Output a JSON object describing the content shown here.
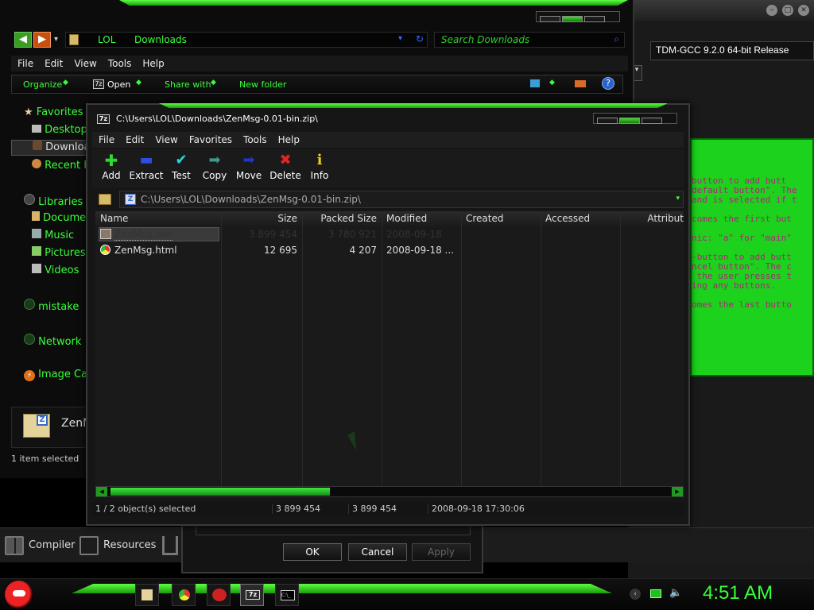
{
  "explorer": {
    "address": [
      "LOL",
      "Downloads"
    ],
    "search_placeholder": "Search Downloads",
    "menu": [
      "File",
      "Edit",
      "View",
      "Tools",
      "Help"
    ],
    "toolbar": [
      "Organize",
      "Open",
      "Share with",
      "New folder"
    ],
    "nav": [
      {
        "label": "Favorites",
        "icon": "star-icon"
      },
      {
        "label": "Desktop",
        "icon": "desktop-icon"
      },
      {
        "label": "Downloads",
        "icon": "downloads-icon"
      },
      {
        "label": "Recent Places",
        "icon": "recent-icon"
      },
      {
        "label": "Libraries",
        "icon": "library-icon"
      },
      {
        "label": "Documents",
        "icon": "documents-icon"
      },
      {
        "label": "Music",
        "icon": "music-icon"
      },
      {
        "label": "Pictures",
        "icon": "pictures-icon"
      },
      {
        "label": "Videos",
        "icon": "videos-icon"
      },
      {
        "label": "mistake",
        "icon": "homegroup-icon"
      },
      {
        "label": "Network",
        "icon": "network-icon"
      },
      {
        "label": "Image Capture",
        "icon": "capture-icon"
      }
    ],
    "preview_name": "ZenMsg",
    "status": "1 item selected"
  },
  "devcpp": {
    "title": "TDM-GCC 9.2.0 64-bit Release",
    "code_lines": [
      "button to add butt",
      "default button\". The",
      "and is selected if t",
      "",
      "comes the first but",
      "",
      "nic: \"a\" for \"main\"",
      "",
      "-button to add butt",
      "ncel button\". The c",
      " the user presses t",
      "ing any buttons.",
      "",
      "omes the last butto"
    ],
    "bottom_tabs": [
      "Compiler",
      "Resources"
    ]
  },
  "dialog": {
    "ok": "OK",
    "cancel": "Cancel",
    "apply": "Apply"
  },
  "sevenzip": {
    "title": "C:\\Users\\LOL\\Downloads\\ZenMsg-0.01-bin.zip\\",
    "title_icon": "7z",
    "menu": [
      "File",
      "Edit",
      "View",
      "Favorites",
      "Tools",
      "Help"
    ],
    "toolbar": [
      {
        "label": "Add",
        "icon": "plus-icon",
        "glyph": "✚",
        "color": "#31d92f"
      },
      {
        "label": "Extract",
        "icon": "minus-icon",
        "glyph": "▬",
        "color": "#2f4de0"
      },
      {
        "label": "Test",
        "icon": "check-icon",
        "glyph": "✔",
        "color": "#2ad6e0"
      },
      {
        "label": "Copy",
        "icon": "copy-arrow-icon",
        "glyph": "➡",
        "color": "#3b9a8d"
      },
      {
        "label": "Move",
        "icon": "move-arrow-icon",
        "glyph": "➡",
        "color": "#2234c8"
      },
      {
        "label": "Delete",
        "icon": "delete-x-icon",
        "glyph": "✖",
        "color": "#e22424"
      },
      {
        "label": "Info",
        "icon": "info-icon",
        "glyph": "i",
        "color": "#e8d21a"
      }
    ],
    "path": "C:\\Users\\LOL\\Downloads\\ZenMsg-0.01-bin.zip\\",
    "columns": [
      "Name",
      "Size",
      "Packed Size",
      "Modified",
      "Created",
      "Accessed",
      "Attribut"
    ],
    "files": [
      {
        "name": "ZenMsg.exe",
        "size": "3 899 454",
        "packed": "3 780 921",
        "modified": "2008-09-18",
        "icon": "exe-icon",
        "selected": true
      },
      {
        "name": "ZenMsg.html",
        "size": "12 695",
        "packed": "4 207",
        "modified": "2008-09-18 ...",
        "icon": "chrome-icon",
        "selected": false
      }
    ],
    "status": {
      "selection": "1 / 2 object(s) selected",
      "size": "3 899 454",
      "packed": "3 899 454",
      "date": "2008-09-18 17:30:06"
    }
  },
  "taskbar": {
    "clock": "4:51 AM",
    "apps": [
      "explorer-icon",
      "chrome-icon",
      "devcpp-icon",
      "7zip-icon",
      "cmd-icon"
    ]
  },
  "colors": {
    "accent": "#39ff39",
    "code_bg": "#1cd21c",
    "code_text": "#b0247a"
  }
}
